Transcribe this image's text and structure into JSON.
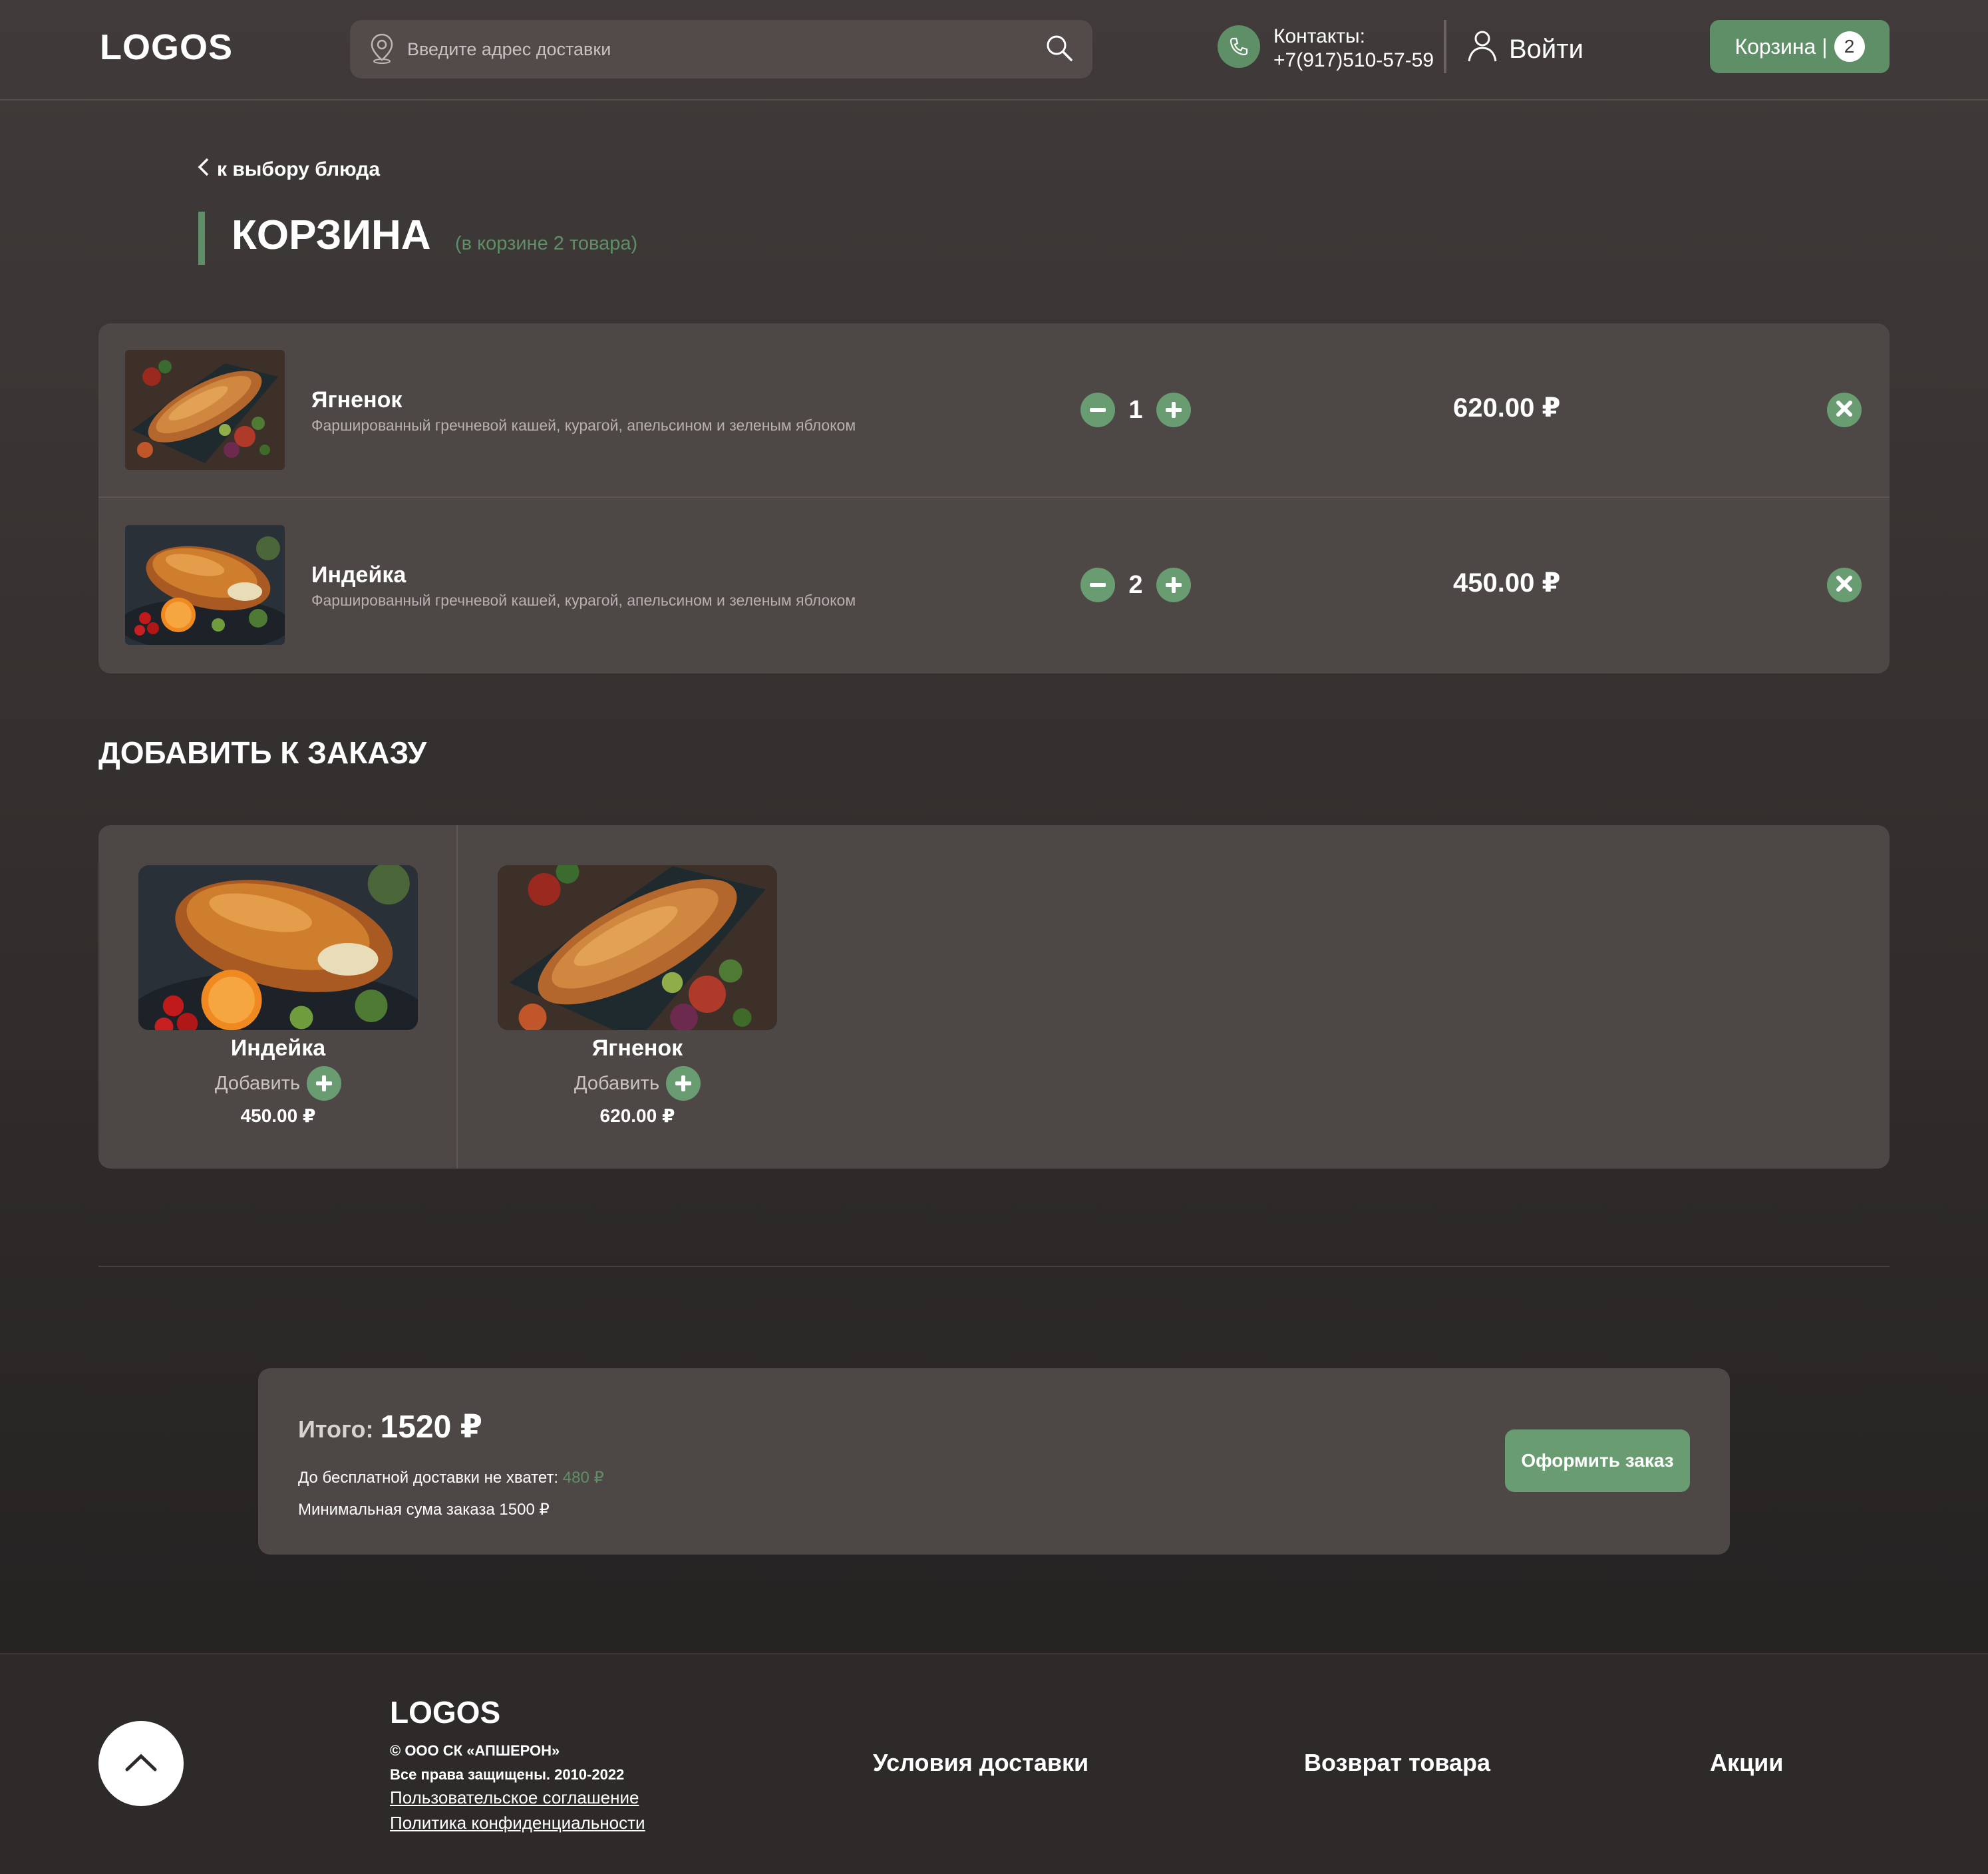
{
  "header": {
    "logo": "LOGOS",
    "search_placeholder": "Введите адрес доставки",
    "contacts_label": "Контакты:",
    "contacts_phone": "+7(917)510-57-59",
    "login_label": "Войти",
    "cart_label": "Корзина |",
    "cart_count": "2"
  },
  "page": {
    "back_label": "к выбору блюда",
    "title": "КОРЗИНА",
    "subtitle": "(в корзине 2 товара)"
  },
  "cart": {
    "items": [
      {
        "name": "Ягненок",
        "description": "Фаршированный гречневой кашей, курагой, апельсином и зеленым яблоком",
        "quantity": "1",
        "price": "620.00 ₽",
        "image": "roasted-lamb-photo"
      },
      {
        "name": "Индейка",
        "description": "Фаршированный гречневой кашей, курагой, апельсином и зеленым яблоком",
        "quantity": "2",
        "price": "450.00 ₽",
        "image": "roasted-turkey-photo"
      }
    ]
  },
  "add_to_order": {
    "title": "ДОБАВИТЬ К ЗАКАЗУ",
    "items": [
      {
        "name": "Индейка",
        "action_label": "Добавить",
        "price": "450.00 ₽",
        "image": "roasted-turkey-photo"
      },
      {
        "name": "Ягненок",
        "action_label": "Добавить",
        "price": "620.00 ₽",
        "image": "roasted-lamb-photo"
      }
    ]
  },
  "summary": {
    "total_label": "Итого:",
    "total_value": "1520 ₽",
    "free_delivery_label": "До бесплатной доставки не хватет:",
    "free_delivery_amount": "480 ₽",
    "min_sum": "Минимальная сума заказа 1500 ₽",
    "order_button": "Оформить заказ"
  },
  "footer": {
    "logo": "LOGOS",
    "company": "© ООО СК «АПШЕРОН»",
    "rights": "Все права защищены. 2010-2022",
    "link_agreement": "Пользовательское соглашение",
    "link_privacy": "Политика конфиденциальности",
    "nav": [
      "Условия доставки",
      "Возврат товара",
      "Акции"
    ]
  },
  "colors": {
    "accent": "#5e8f67",
    "panel": "#4d4746",
    "background": "#3a3534"
  }
}
